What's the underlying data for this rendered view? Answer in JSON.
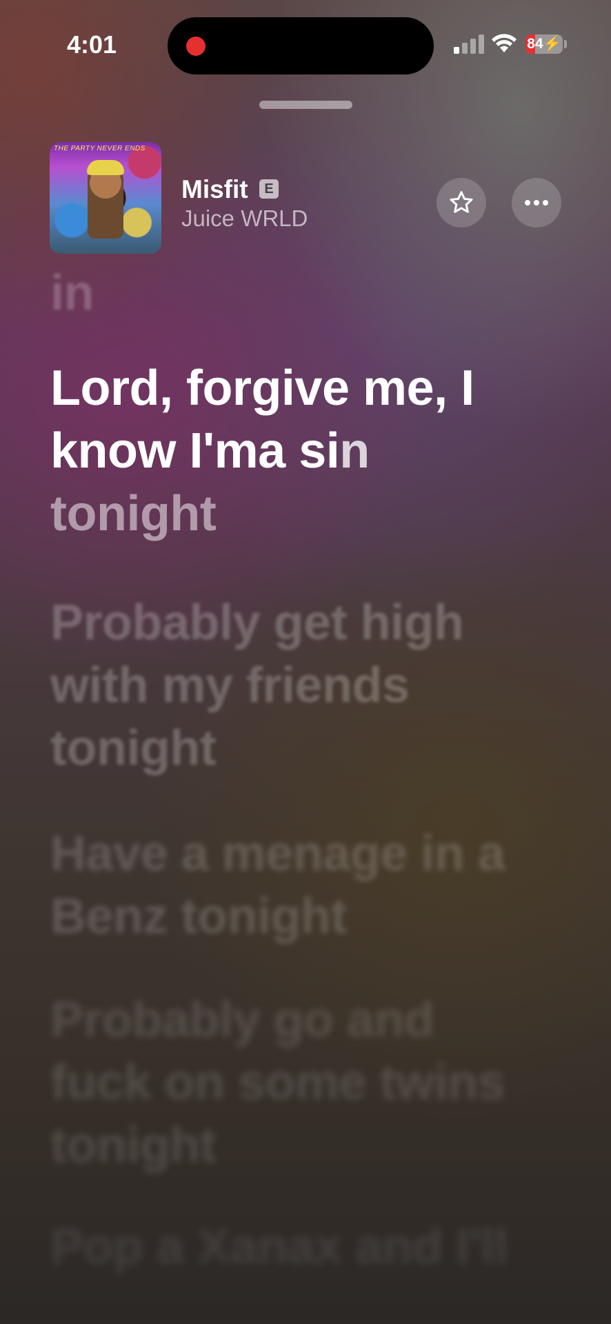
{
  "status_bar": {
    "time": "4:01",
    "battery_percent": "84",
    "battery_level": 0.25,
    "signal_bars_active": 1,
    "icons": [
      "screen-recording-indicator",
      "cellular-signal-icon",
      "wifi-icon",
      "battery-charging-icon"
    ]
  },
  "now_playing": {
    "title": "Misfit",
    "explicit_badge": "E",
    "artist": "Juice WRLD",
    "artwork_caption": "THE PARTY NEVER ENDS",
    "favorite_icon": "star-icon",
    "more_icon": "ellipsis-icon"
  },
  "lyrics": {
    "previous": "in",
    "current_sung": "Lord, forgive me, I know I'ma si",
    "current_partial": "n",
    "current_rest": "tonight",
    "upcoming": [
      "Probably get high with my friends tonight",
      "Have a menage in a Benz tonight",
      "Probably go and fuck on some twins tonight",
      "Pop a Xanax and I'll"
    ]
  },
  "colors": {
    "accent_recording": "#e5302f",
    "battery_low": "#e5302f"
  }
}
